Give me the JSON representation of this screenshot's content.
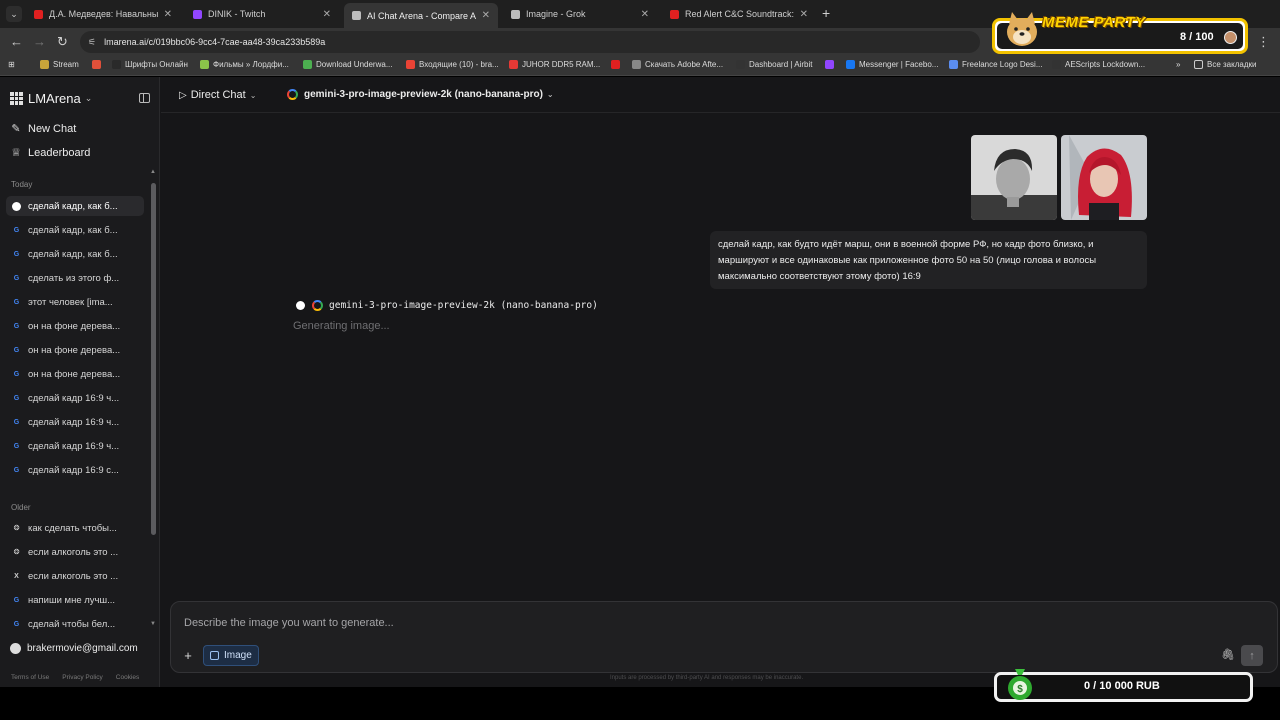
{
  "browser": {
    "tabs": [
      {
        "label": "Д.А. Медведев: Навальный, кр",
        "favicon_color": "#e02020"
      },
      {
        "label": "DINIK - Twitch",
        "favicon_color": "#9146ff"
      },
      {
        "label": "AI Chat Arena - Compare AI Mo",
        "favicon_color": "#bdbdbd",
        "active": true
      },
      {
        "label": "Imagine - Grok",
        "favicon_color": "#bdbdbd"
      },
      {
        "label": "Red Alert C&C Soundtrack: Hell",
        "favicon_color": "#e02020"
      }
    ],
    "url": "lmarena.ai/c/019bbc06-9cc4-7cae-aa48-39ca233b589a",
    "bookmarks": [
      {
        "label": "Stream",
        "icon_color": "#c9a43a"
      },
      {
        "label": "",
        "icon_color": "#e0503a"
      },
      {
        "label": "Шрифты Онлайн",
        "icon_color": "#2a2a2a"
      },
      {
        "label": "Фильмы » Лордфи...",
        "icon_color": "#8bc34a"
      },
      {
        "label": "Download Underwa...",
        "icon_color": "#4caf50"
      },
      {
        "label": "Входящие (10) - bra...",
        "icon_color": "#ea4335"
      },
      {
        "label": "JUHOR DDR5 RAM...",
        "icon_color": "#e53935"
      },
      {
        "label": "",
        "icon_color": "#e02020"
      },
      {
        "label": "Скачать Adobe Afte...",
        "icon_color": "#888888"
      },
      {
        "label": "Dashboard | Airbit",
        "icon_color": "#333333"
      },
      {
        "label": "",
        "icon_color": "#9146ff"
      },
      {
        "label": "Messenger | Facebo...",
        "icon_color": "#1877f2"
      },
      {
        "label": "Freelance Logo Desi...",
        "icon_color": "#5b8def"
      },
      {
        "label": "AEScripts Lockdown...",
        "icon_color": "#333333"
      }
    ],
    "bookmarks_more": "»",
    "all_bookmarks": "Все закладки"
  },
  "meme_party": {
    "title": "MEME PARTY",
    "count": "8 / 100"
  },
  "sidebar": {
    "brand": "LMArena",
    "new_chat": "New Chat",
    "leaderboard": "Leaderboard",
    "today_label": "Today",
    "today": [
      {
        "label": "сделай кадр, как б...",
        "icon": "dot",
        "selected": true
      },
      {
        "label": "сделай кадр, как б...",
        "icon": "G"
      },
      {
        "label": "сделай кадр, как б...",
        "icon": "G"
      },
      {
        "label": "сделать из этого ф...",
        "icon": "G"
      },
      {
        "label": "этот человек [ima...",
        "icon": "G"
      },
      {
        "label": "он на фоне дерева...",
        "icon": "G"
      },
      {
        "label": "он на фоне дерева...",
        "icon": "G"
      },
      {
        "label": "он на фоне дерева...",
        "icon": "G"
      },
      {
        "label": "сделай кадр 16:9 ч...",
        "icon": "G"
      },
      {
        "label": "сделай кадр 16:9 ч...",
        "icon": "G"
      },
      {
        "label": "сделай кадр 16:9 ч...",
        "icon": "G"
      },
      {
        "label": "сделай кадр 16:9 с...",
        "icon": "G"
      }
    ],
    "older_label": "Older",
    "older": [
      {
        "label": "как сделать чтобы...",
        "icon": "openai"
      },
      {
        "label": "если алкоголь это ...",
        "icon": "openai"
      },
      {
        "label": "если алкоголь это ...",
        "icon": "x"
      },
      {
        "label": "напиши мне лучш...",
        "icon": "G"
      },
      {
        "label": "сделай чтобы бел...",
        "icon": "G"
      }
    ],
    "account": "brakermovie@gmail.com",
    "footer_links": [
      "Terms of Use",
      "Privacy Policy",
      "Cookies"
    ]
  },
  "topbar": {
    "mode": "Direct Chat",
    "model": "gemini-3-pro-image-preview-2k (nano-banana-pro)"
  },
  "conversation": {
    "user_message": "сделай кадр, как будто идёт марш, они в военной форме РФ, но кадр фото близко, и маршируют и все одинаковые как приложенное фото 50 на 50 (лицо голова и волосы максимально соответствуют этому фото) 16:9",
    "response_model": "gemini-3-pro-image-preview-2k (nano-banana-pro)",
    "response_status": "Generating image..."
  },
  "composer": {
    "placeholder": "Describe the image you want to generate...",
    "image_chip": "Image"
  },
  "disclaimer": "Inputs are processed by third-party AI and responses may be inaccurate.",
  "rub_overlay": {
    "text": "0 / 10 000 RUB"
  }
}
